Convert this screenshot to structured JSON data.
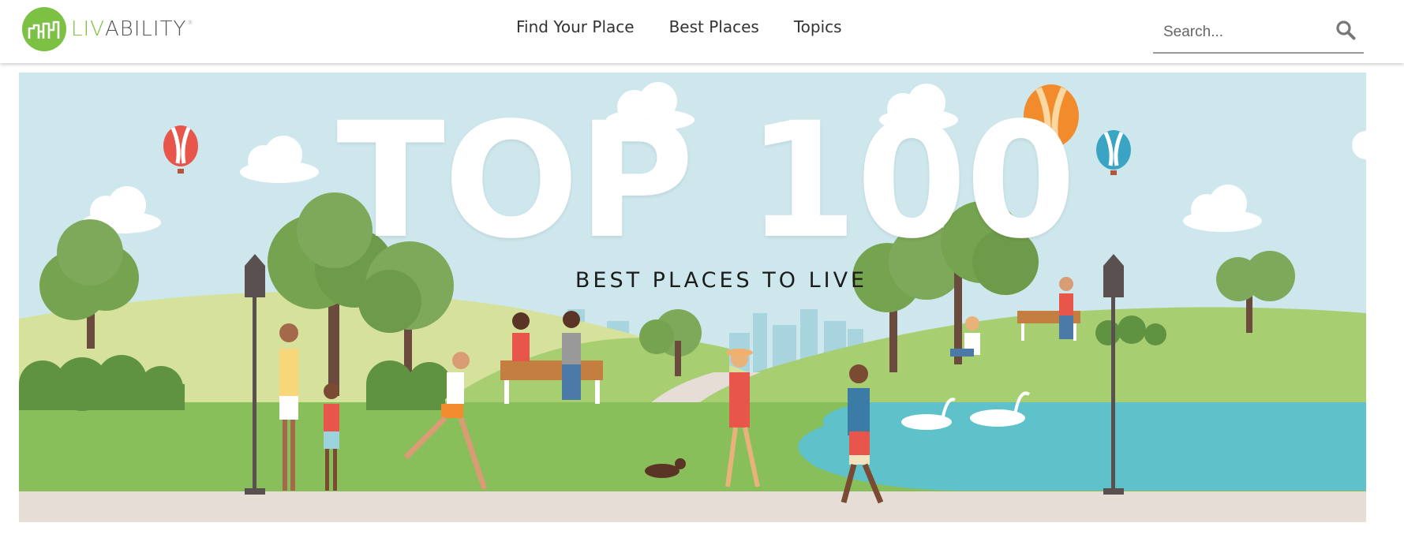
{
  "header": {
    "logo": {
      "part1": "LIV",
      "part2": "ABILITY",
      "reg": "®"
    },
    "nav": [
      {
        "label": "Find Your Place"
      },
      {
        "label": "Best Places"
      },
      {
        "label": "Topics"
      }
    ],
    "search": {
      "placeholder": "Search..."
    }
  },
  "hero": {
    "title": "TOP 100",
    "subtitle": "BEST PLACES TO LIVE"
  },
  "colors": {
    "brand_green": "#7cc143",
    "sky": "#cde7ec",
    "grass": "#8bbf5c",
    "lake": "#5fc1c9",
    "path": "#e6ddd6"
  }
}
